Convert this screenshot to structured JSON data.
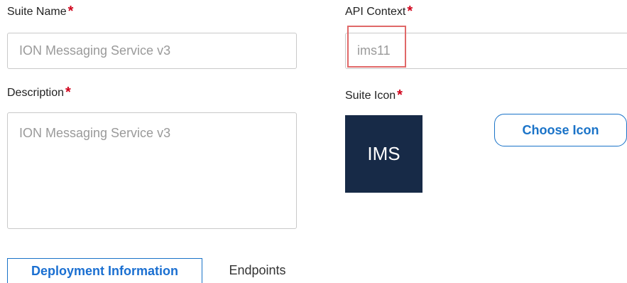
{
  "form": {
    "suite_name": {
      "label": "Suite Name",
      "required_mark": "*",
      "placeholder": "ION Messaging Service v3"
    },
    "api_context": {
      "label": "API Context",
      "required_mark": "*",
      "value": "ims11"
    },
    "description": {
      "label": "Description",
      "required_mark": "*",
      "placeholder": "ION Messaging Service v3"
    },
    "suite_icon": {
      "label": "Suite Icon",
      "required_mark": "*",
      "icon_text": "IMS",
      "button_label": "Choose Icon"
    }
  },
  "tabs": [
    {
      "label": "Deployment Information",
      "active": true
    },
    {
      "label": "Endpoints",
      "active": false
    }
  ],
  "colors": {
    "accent": "#1a73c8",
    "required": "#d0021b",
    "icon_bg": "#172a47",
    "highlight": "#e06868"
  }
}
